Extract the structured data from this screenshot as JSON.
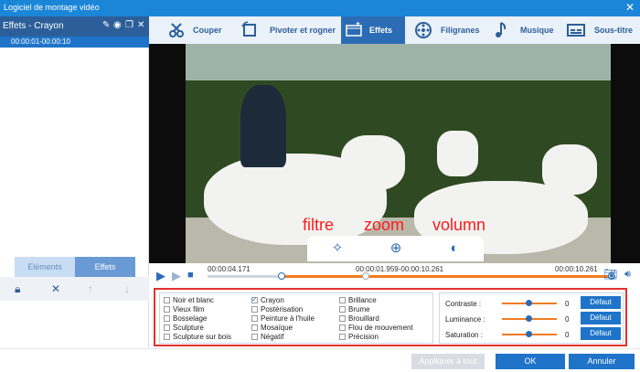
{
  "window": {
    "title": "Logiciel de montage vidéo",
    "close_glyph": "✕"
  },
  "left_panel": {
    "header_title": "Effets - Crayon",
    "header_icons": [
      "pencil-icon",
      "eye-icon",
      "copy-icon",
      "close-icon"
    ],
    "clip_range": "00:00:01-00:00:10",
    "tabs": [
      "Eléments",
      "Effets"
    ],
    "tools": [
      "lock-icon",
      "delete-icon",
      "arrow-up-icon",
      "arrow-down-icon"
    ]
  },
  "top_tabs": [
    {
      "label": "Couper",
      "icon": "cut-icon"
    },
    {
      "label": "Pivoter et rogner",
      "icon": "rotate-crop-icon"
    },
    {
      "label": "Effets",
      "icon": "effects-icon",
      "active": true
    },
    {
      "label": "Filigranes",
      "icon": "watermark-icon"
    },
    {
      "label": "Musique",
      "icon": "music-icon"
    },
    {
      "label": "Sous-titre",
      "icon": "subtitle-icon"
    }
  ],
  "annotations": {
    "filter": "filtre",
    "zoom": "zoom",
    "volume": "volumn"
  },
  "timeline": {
    "current_time": "00:00:04.171",
    "range": "00:00:01.959-00:00:10.261",
    "end_time": "00:00:10.261"
  },
  "effects": {
    "col1": [
      "Noir et blanc",
      "Vieux film",
      "Bosselage",
      "Sculpture",
      "Sculpture sur bois"
    ],
    "col2": [
      "Crayon",
      "Postérisation",
      "Peinture à l'huile",
      "Mosaïque",
      "Négatif"
    ],
    "col3": [
      "Brillance",
      "Brume",
      "Brouillard",
      "Flou de mouvement",
      "Précision"
    ],
    "checked": "Crayon"
  },
  "adjustments": [
    {
      "label": "Contraste :",
      "value": "0",
      "button": "Défaut"
    },
    {
      "label": "Luminance :",
      "value": "0",
      "button": "Défaut"
    },
    {
      "label": "Saturation :",
      "value": "0",
      "button": "Défaut"
    }
  ],
  "buttons": {
    "apply_all": "Appliquer à tout",
    "ok": "OK",
    "cancel": "Annuler"
  },
  "colors": {
    "accent": "#1f74c9",
    "header": "#2c5f9a",
    "progress": "#f47b20",
    "annotation": "#ff1a1a"
  }
}
